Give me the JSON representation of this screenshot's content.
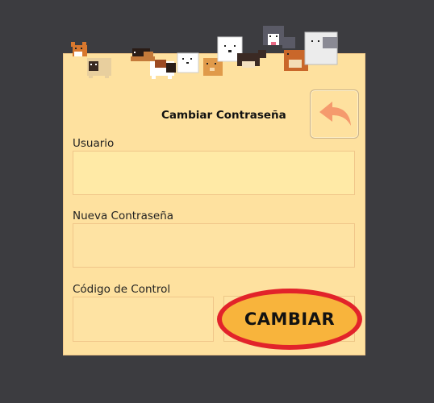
{
  "form": {
    "title": "Cambiar Contraseña",
    "fields": {
      "usuario_label": "Usuario",
      "usuario_value": "",
      "nueva_label": "Nueva Contraseña",
      "nueva_value": "",
      "codigo_label": "Código de Control",
      "codigo_value": ""
    },
    "submit_label": "CAMBIAR"
  },
  "icons": {
    "back": "back-arrow-icon",
    "header": "pixel-dogs-banner"
  },
  "colors": {
    "page_bg": "#3c3c40",
    "panel_bg": "#fee19f",
    "input_bg": "#ffeaa6",
    "button_fill": "#f8b43c",
    "button_ring": "#e2232a",
    "back_arrow": "#f59a6d"
  }
}
